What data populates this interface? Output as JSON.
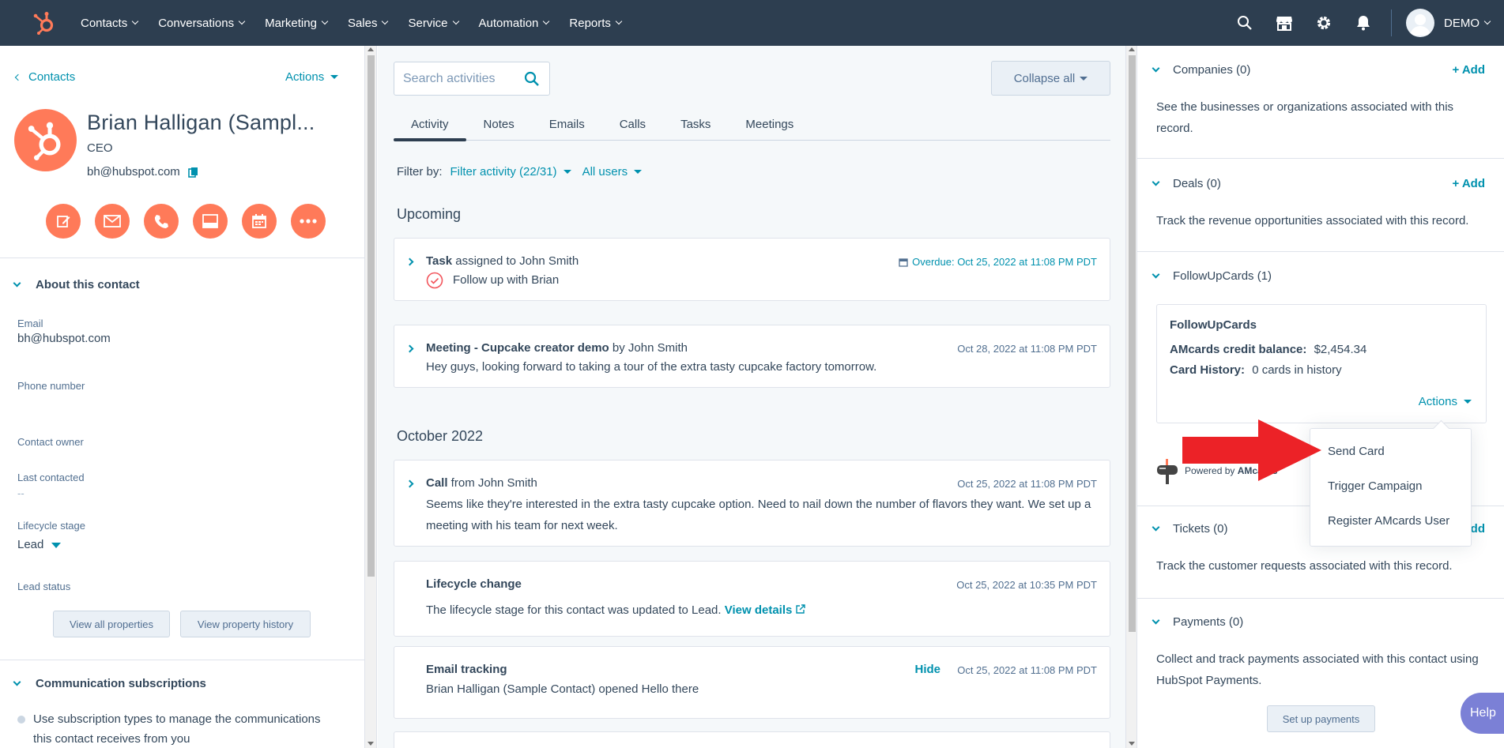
{
  "nav": {
    "items": [
      "Contacts",
      "Conversations",
      "Marketing",
      "Sales",
      "Service",
      "Automation",
      "Reports"
    ],
    "user": "DEMO"
  },
  "left": {
    "back": "Contacts",
    "actions": "Actions",
    "name": "Brian Halligan (Sampl...",
    "title": "CEO",
    "email": "bh@hubspot.com",
    "about_title": "About this contact",
    "props": {
      "email_label": "Email",
      "email_value": "bh@hubspot.com",
      "phone_label": "Phone number",
      "owner_label": "Contact owner",
      "last_contacted_label": "Last contacted",
      "last_contacted_value": "--",
      "lifecycle_label": "Lifecycle stage",
      "lifecycle_value": "Lead",
      "lead_status_label": "Lead status"
    },
    "view_all": "View all properties",
    "view_history": "View property history",
    "comm_title": "Communication subscriptions",
    "comm_text": "Use subscription types to manage the communications this contact receives from you"
  },
  "middle": {
    "search_placeholder": "Search activities",
    "collapse": "Collapse all",
    "tabs": [
      "Activity",
      "Notes",
      "Emails",
      "Calls",
      "Tasks",
      "Meetings"
    ],
    "filter_by": "Filter by:",
    "filter_activity": "Filter activity (22/31)",
    "all_users": "All users",
    "upcoming": "Upcoming",
    "month": "October 2022",
    "task": {
      "type": "Task",
      "rest": " assigned to John Smith",
      "date": "Overdue: Oct 25, 2022 at 11:08 PM PDT",
      "body": "Follow up with Brian"
    },
    "meeting": {
      "type": "Meeting - Cupcake creator demo",
      "rest": " by John Smith",
      "date": "Oct 28, 2022 at 11:08 PM PDT",
      "body": "Hey guys, looking forward to taking a tour of the extra tasty cupcake factory tomorrow."
    },
    "call": {
      "type": "Call",
      "rest": " from John Smith",
      "date": "Oct 25, 2022 at 11:08 PM PDT",
      "body": "Seems like they're interested in the extra tasty cupcake option. Need to nail down the number of flavors they want. We set up a meeting with his team for next week."
    },
    "lifecycle": {
      "type": "Lifecycle change",
      "date": "Oct 25, 2022 at 10:35 PM PDT",
      "body": "The lifecycle stage for this contact was updated to Lead.",
      "link": "View details"
    },
    "tracking": {
      "type": "Email tracking",
      "hide": "Hide",
      "date": "Oct 25, 2022 at 11:08 PM PDT",
      "body": "Brian Halligan (Sample Contact) opened Hello there"
    }
  },
  "right": {
    "companies": "Companies (0)",
    "companies_text": "See the businesses or organizations associated with this record.",
    "deals": "Deals (0)",
    "deals_text": "Track the revenue opportunities associated with this record.",
    "add": "+ Add",
    "followup": "FollowUpCards (1)",
    "fu_title": "FollowUpCards",
    "fu_balance_label": "AMcards credit balance:",
    "fu_balance_value": "$2,454.34",
    "fu_history_label": "Card History:",
    "fu_history_value": "0 cards in history",
    "fu_actions": "Actions",
    "powered_by": "Powered by",
    "powered_brand": "AMcards",
    "dropdown": [
      "Send Card",
      "Trigger Campaign",
      "Register AMcards User"
    ],
    "tickets": "Tickets (0)",
    "tickets_add": "dd",
    "tickets_text": "Track the customer requests associated with this record.",
    "payments": "Payments (0)",
    "payments_text": "Collect and track payments associated with this contact using HubSpot Payments.",
    "setup": "Set up payments",
    "help": "Help"
  },
  "colors": {
    "nav_bg": "#2d3e50",
    "accent": "#0091ae",
    "orange": "#ff7a59",
    "arrow": "#e8262b"
  }
}
